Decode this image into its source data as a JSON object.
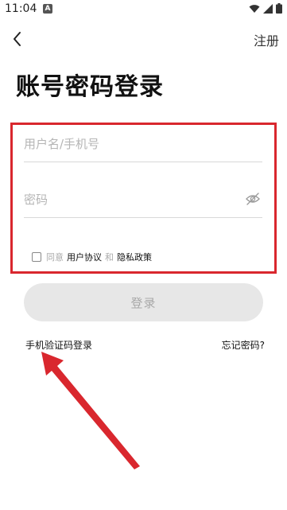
{
  "status_bar": {
    "time": "11:04",
    "notification_letter": "A"
  },
  "nav": {
    "register_label": "注册"
  },
  "page_title": "账号密码登录",
  "form": {
    "username_placeholder": "用户名/手机号",
    "password_placeholder": "密码"
  },
  "agreement": {
    "prefix": "同意",
    "user_agreement": "用户协议",
    "and": "和",
    "privacy_policy": "隐私政策"
  },
  "login_button_label": "登录",
  "links": {
    "sms_login": "手机验证码登录",
    "forgot_password": "忘记密码?"
  },
  "colors": {
    "highlight_border": "#d9272e",
    "annotation_arrow": "#d9272e",
    "button_disabled_bg": "#e7e7e7"
  }
}
